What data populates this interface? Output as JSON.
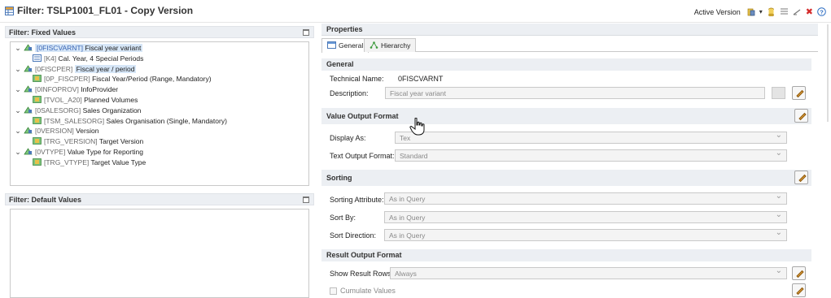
{
  "window": {
    "title": "Filter: TSLP1001_FL01 - Copy Version",
    "active_version_label": "Active Version"
  },
  "left": {
    "fixed_values": {
      "header": "Filter: Fixed Values",
      "tree": [
        {
          "level": 0,
          "expanded": true,
          "code": "[0FISCVARNT]",
          "label": "Fiscal year variant",
          "selected": true,
          "code_style": "blue"
        },
        {
          "level": 1,
          "code": "[K4]",
          "label": "Cal. Year, 4 Special Periods",
          "code_style": "gray"
        },
        {
          "level": 0,
          "expanded": true,
          "code": "[0FISCPER]",
          "label": "Fiscal year / period",
          "selected_label": true,
          "code_style": "gray"
        },
        {
          "level": 1,
          "code": "[0P_FISCPER]",
          "label": "Fiscal Year/Period (Range, Mandatory)",
          "code_style": "gray"
        },
        {
          "level": 0,
          "expanded": true,
          "code": "[0INFOPROV]",
          "label": "InfoProvider",
          "code_style": "gray"
        },
        {
          "level": 1,
          "code": "[TVOL_A20]",
          "label": "Planned Volumes",
          "code_style": "gray"
        },
        {
          "level": 0,
          "expanded": true,
          "code": "[0SALESORG]",
          "label": "Sales Organization",
          "code_style": "gray"
        },
        {
          "level": 1,
          "code": "[TSM_SALESORG]",
          "label": "Sales Organisation (Single, Mandatory)",
          "code_style": "gray"
        },
        {
          "level": 0,
          "expanded": true,
          "code": "[0VERSION]",
          "label": "Version",
          "code_style": "gray"
        },
        {
          "level": 1,
          "code": "[TRG_VERSION]",
          "label": "Target Version",
          "code_style": "gray"
        },
        {
          "level": 0,
          "expanded": true,
          "code": "[0VTYPE]",
          "label": "Value Type for Reporting",
          "code_style": "gray"
        },
        {
          "level": 1,
          "code": "[TRG_VTYPE]",
          "label": "Target Value Type",
          "code_style": "gray"
        }
      ]
    },
    "default_values": {
      "header": "Filter: Default Values"
    }
  },
  "properties": {
    "header": "Properties",
    "tabs": [
      {
        "label": "General",
        "active": true
      },
      {
        "label": "Hierarchy",
        "active": false
      }
    ],
    "general": {
      "header": "General",
      "technical_name_label": "Technical Name:",
      "technical_name_value": "0FISCVARNT",
      "description_label": "Description:",
      "description_value": "Fiscal year variant"
    },
    "value_output": {
      "header": "Value Output Format",
      "display_as_label": "Display As:",
      "display_as_value": "Tex",
      "text_output_label": "Text Output Format:",
      "text_output_value": "Standard"
    },
    "sorting": {
      "header": "Sorting",
      "attribute_label": "Sorting Attribute:",
      "attribute_value": "As in Query",
      "sort_by_label": "Sort By:",
      "sort_by_value": "As in Query",
      "direction_label": "Sort Direction:",
      "direction_value": "As in Query"
    },
    "result_output": {
      "header": "Result Output Format",
      "show_rows_label": "Show Result Rows:",
      "show_rows_value": "Always",
      "cumulate_label": "Cumulate Values"
    }
  },
  "colors": {
    "header_bg": "#eceff3",
    "selection": "#d6e6f7",
    "code_blue": "#3a66b5",
    "code_gray": "#6b6b6b"
  }
}
